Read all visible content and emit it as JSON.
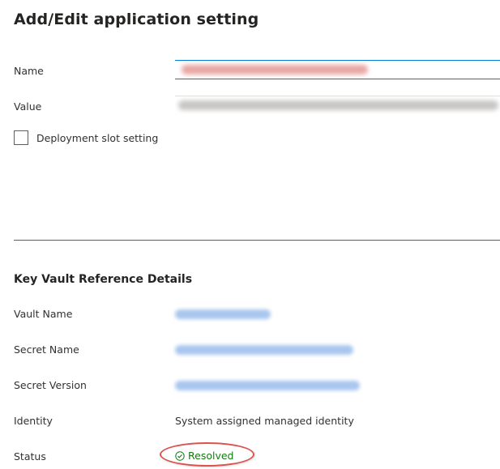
{
  "title": "Add/Edit application setting",
  "form": {
    "name_label": "Name",
    "value_label": "Value",
    "slot_setting_label": "Deployment slot setting",
    "slot_setting_checked": false
  },
  "details": {
    "section_title": "Key Vault Reference Details",
    "vault_name_label": "Vault Name",
    "secret_name_label": "Secret Name",
    "secret_version_label": "Secret Version",
    "identity_label": "Identity",
    "identity_value": "System assigned managed identity",
    "status_label": "Status",
    "status_value": "Resolved"
  },
  "colors": {
    "accent": "#0078d4",
    "status_success": "#107c10",
    "highlight": "#d9534f",
    "redacted_name": "#e8a6a3",
    "redacted_value": "#c8c6c4",
    "redacted_link": "#a9c6ee"
  },
  "icons": {
    "status": "check-circle-icon",
    "checkbox": "checkbox-icon"
  }
}
